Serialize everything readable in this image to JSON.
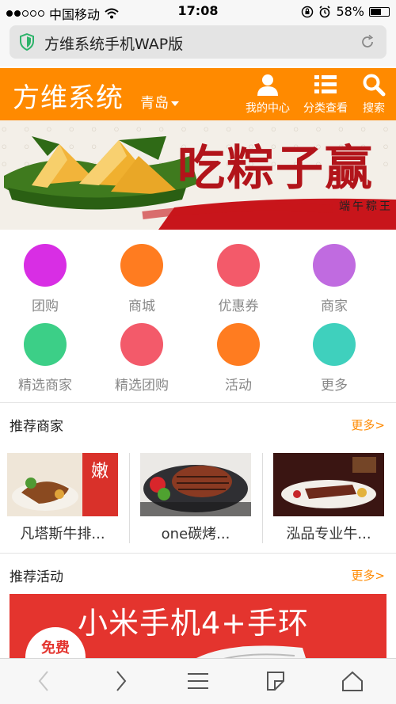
{
  "status_bar": {
    "carrier": "中国移动",
    "time": "17:08",
    "battery": "58%",
    "battery_level": 0.58,
    "signal_bars": 2
  },
  "address_bar": {
    "url_text": "方维系统手机WAP版"
  },
  "header": {
    "logo": "方维系统",
    "city": "青岛",
    "nav": [
      {
        "label": "我的中心",
        "icon": "user-icon"
      },
      {
        "label": "分类查看",
        "icon": "list-icon"
      },
      {
        "label": "搜索",
        "icon": "search-icon"
      }
    ],
    "bg_color": "#ff8a00"
  },
  "banner": {
    "slogan": "吃粽子赢",
    "sub": "端午粽王"
  },
  "categories": [
    {
      "label": "团购",
      "color": "#d82ee4"
    },
    {
      "label": "商城",
      "color": "#ff7c20"
    },
    {
      "label": "优惠券",
      "color": "#f35a6a"
    },
    {
      "label": "商家",
      "color": "#c06be0"
    },
    {
      "label": "精选商家",
      "color": "#3ccf87"
    },
    {
      "label": "精选团购",
      "color": "#f35a6a"
    },
    {
      "label": "活动",
      "color": "#ff7c20"
    },
    {
      "label": "更多",
      "color": "#3fd0bd"
    }
  ],
  "recommended_shops": {
    "title": "推荐商家",
    "more": "更多>",
    "items": [
      {
        "name": "凡塔斯牛排..."
      },
      {
        "name": "one碳烤..."
      },
      {
        "name": "泓品专业牛..."
      }
    ]
  },
  "recommended_events": {
    "title": "推荐活动",
    "more": "更多>",
    "promo_title": "小米手机4+手环",
    "promo_badge": "免费"
  }
}
